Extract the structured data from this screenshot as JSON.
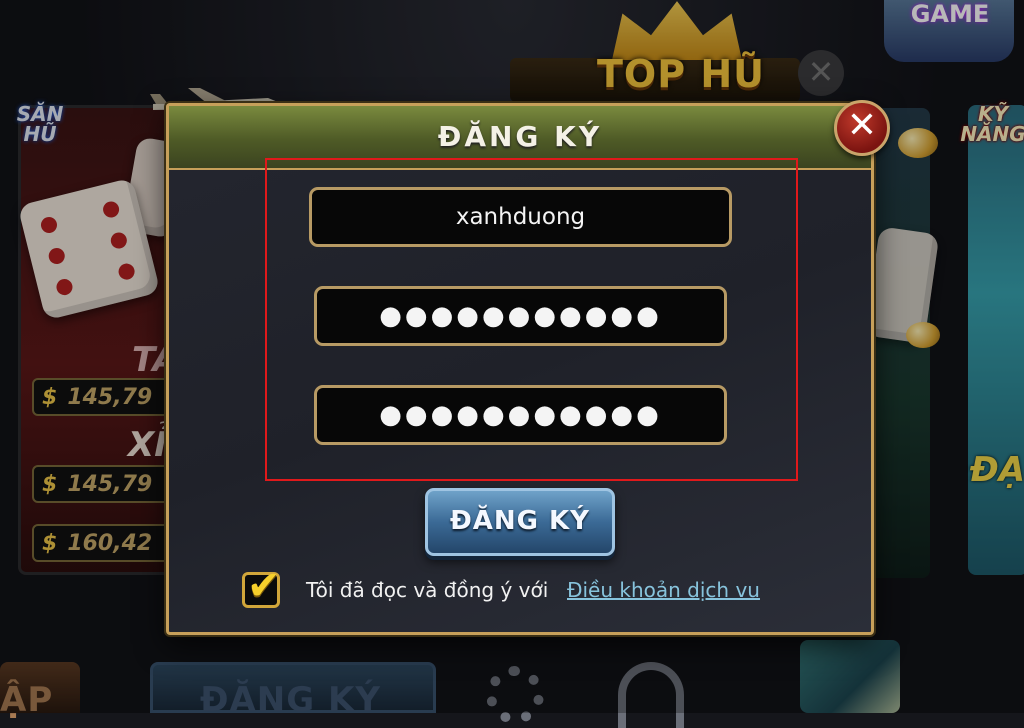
{
  "background": {
    "top_badge_game": "GAME",
    "top_jackpot_title": "TOP HŨ",
    "left_card_badge": "SĂN HŨ",
    "right_card_badge": "KỸ NĂNG",
    "left_card_jackpots": [
      "145,79",
      "145,79",
      "160,42"
    ],
    "left_card_partial_text": [
      "TÀ",
      "XỈ"
    ],
    "right_card_partial_text": [
      "ĐẠ"
    ],
    "bottom_left_partial": "ẬP",
    "bottom_register_label": "ĐĂNG KÝ"
  },
  "modal": {
    "title": "ĐĂNG KÝ",
    "close_label": "✕",
    "username_value": "xanhduong",
    "password_value": "●●●●●●●●●●●",
    "confirm_password_value": "●●●●●●●●●●●",
    "submit_label": "ĐĂNG KÝ",
    "agree_checked": true,
    "agree_text": "Tôi đã đọc và đồng ý với",
    "terms_link": "Điều khoản dịch vu"
  },
  "colors": {
    "modal_border": "#c7a05a",
    "header_green": "#5a6a2e",
    "highlight_red": "#e0191b",
    "submit_blue": "#3b6a96",
    "link_blue": "#87c3dc"
  },
  "icons": [
    "close-icon",
    "check-icon",
    "gear-icon",
    "headphone-icon",
    "crown-icon",
    "dice-icon",
    "airplane-icon",
    "cash-icon"
  ]
}
